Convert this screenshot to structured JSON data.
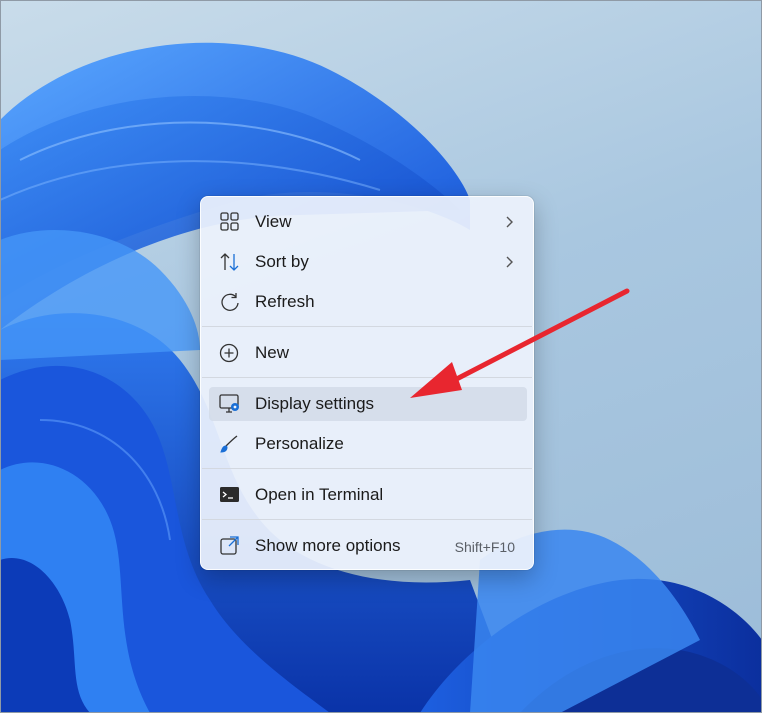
{
  "desktop": {
    "wallpaper_icon": "windows-11-bloom-wallpaper"
  },
  "context_menu": {
    "items": [
      {
        "label": "View",
        "icon": "grid-icon",
        "submenu": true
      },
      {
        "label": "Sort by",
        "icon": "sort-icon",
        "submenu": true
      },
      {
        "label": "Refresh",
        "icon": "refresh-icon",
        "submenu": false
      },
      {
        "label": "New",
        "icon": "add-circle-icon",
        "submenu": true
      },
      {
        "label": "Display settings",
        "icon": "display-settings-icon",
        "submenu": false,
        "highlighted": true
      },
      {
        "label": "Personalize",
        "icon": "brush-icon",
        "submenu": false
      },
      {
        "label": "Open in Terminal",
        "icon": "terminal-icon",
        "submenu": false
      },
      {
        "label": "Show more options",
        "icon": "share-icon",
        "submenu": false,
        "shortcut": "Shift+F10"
      }
    ]
  },
  "annotation": {
    "arrow_color": "#e8262f",
    "points_to": "Display settings"
  }
}
